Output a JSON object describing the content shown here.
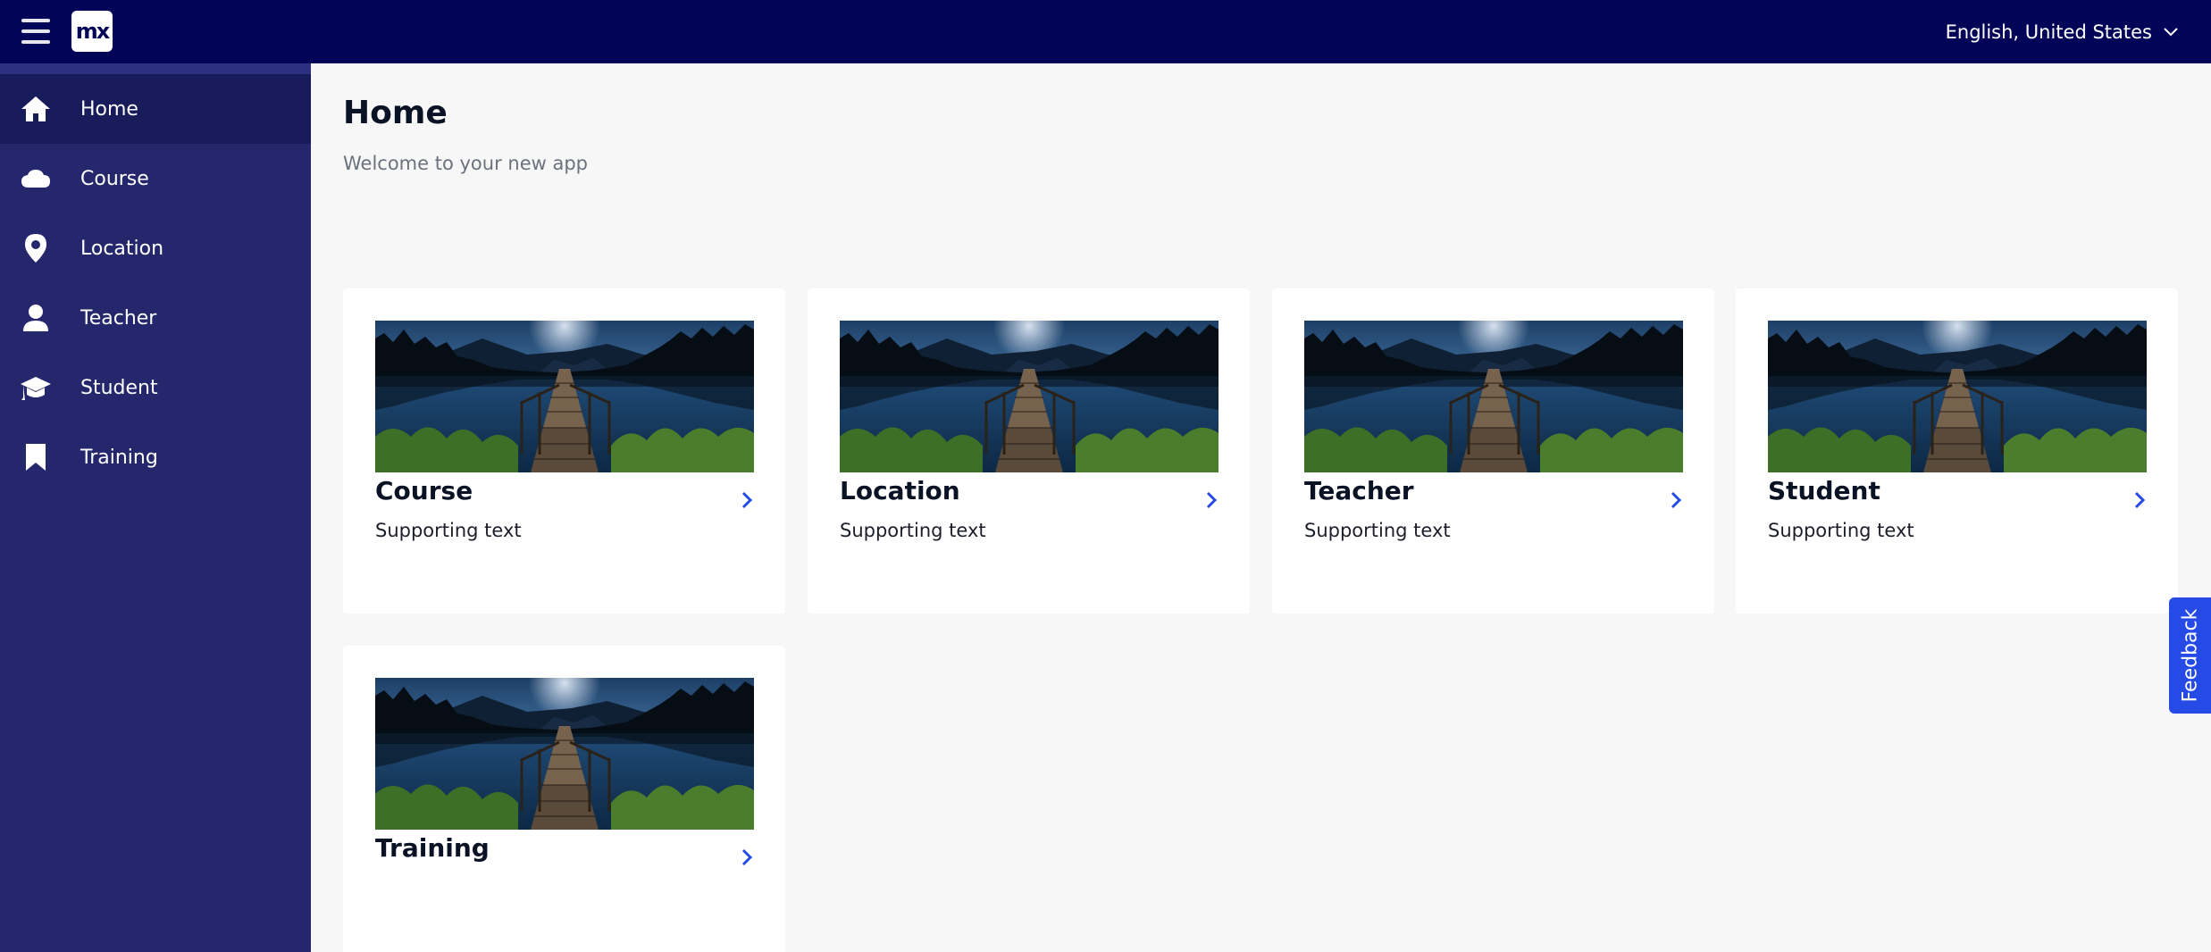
{
  "header": {
    "logo_text": "mx",
    "language": "English, United States"
  },
  "sidebar": {
    "items": [
      {
        "label": "Home",
        "icon": "home-icon",
        "active": true
      },
      {
        "label": "Course",
        "icon": "cloud-icon",
        "active": false
      },
      {
        "label": "Location",
        "icon": "map-pin-icon",
        "active": false
      },
      {
        "label": "Teacher",
        "icon": "user-icon",
        "active": false
      },
      {
        "label": "Student",
        "icon": "graduation-cap-icon",
        "active": false
      },
      {
        "label": "Training",
        "icon": "bookmark-icon",
        "active": false
      }
    ]
  },
  "main": {
    "title": "Home",
    "subtitle": "Welcome to your new app",
    "cards": [
      {
        "title": "Course",
        "text": "Supporting text"
      },
      {
        "title": "Location",
        "text": "Supporting text"
      },
      {
        "title": "Teacher",
        "text": "Supporting text"
      },
      {
        "title": "Student",
        "text": "Supporting text"
      },
      {
        "title": "Training",
        "text": ""
      }
    ]
  },
  "feedback": {
    "label": "Feedback"
  },
  "colors": {
    "topbar": "#020557",
    "sidebar": "#24276c",
    "sidebar_active": "#191c5a",
    "accent": "#264ae5",
    "background": "#f7f7f7"
  }
}
